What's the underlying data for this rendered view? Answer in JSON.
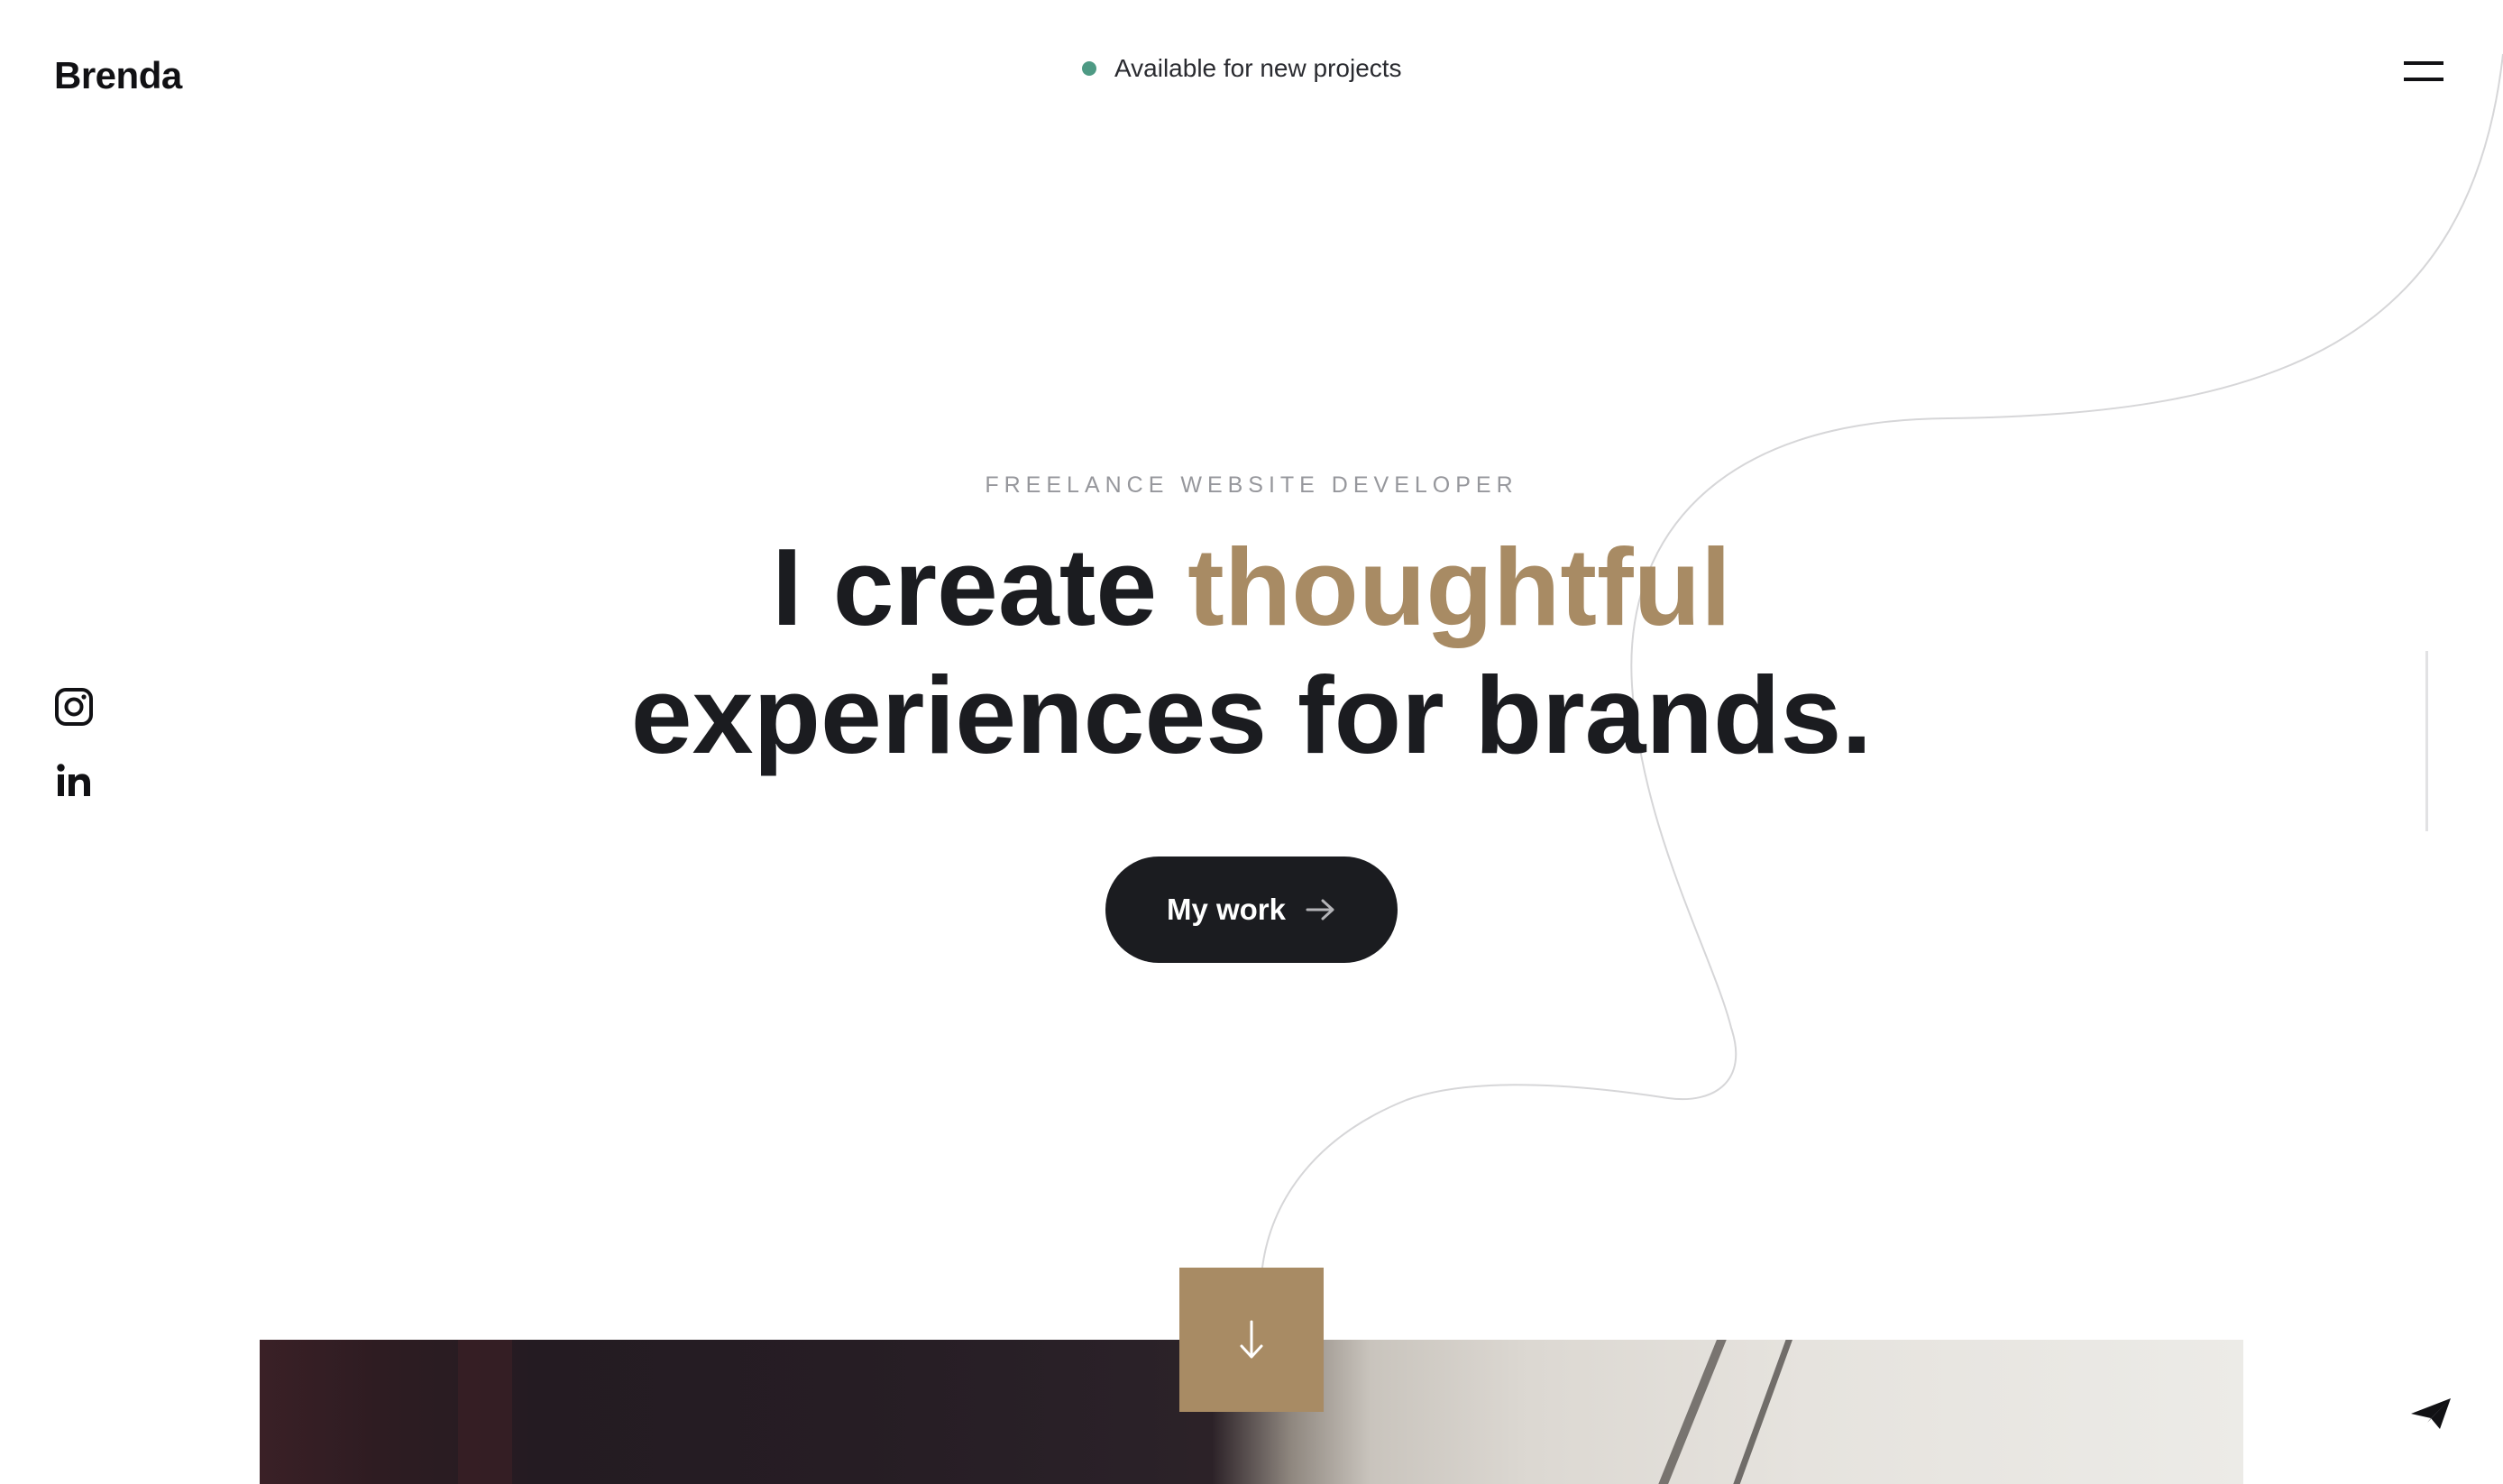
{
  "header": {
    "logo": "Brenda",
    "status_text": "Available for new projects",
    "status_color": "#4e9a84",
    "menu_icon": "hamburger-menu-icon"
  },
  "social": [
    {
      "name": "instagram",
      "icon": "instagram-icon"
    },
    {
      "name": "linkedin",
      "icon": "linkedin-icon"
    }
  ],
  "hero": {
    "eyebrow": "FREELANCE WEBSITE DEVELOPER",
    "headline_part1": "I create ",
    "headline_accent": "thoughtful",
    "headline_part2": "experiences for brands.",
    "cta_label": "My work",
    "cta_icon": "arrow-right-icon",
    "accent_color": "#a88b64"
  },
  "scroll_down": {
    "icon": "arrow-down-icon"
  },
  "contact": {
    "icon": "paper-plane-icon"
  }
}
